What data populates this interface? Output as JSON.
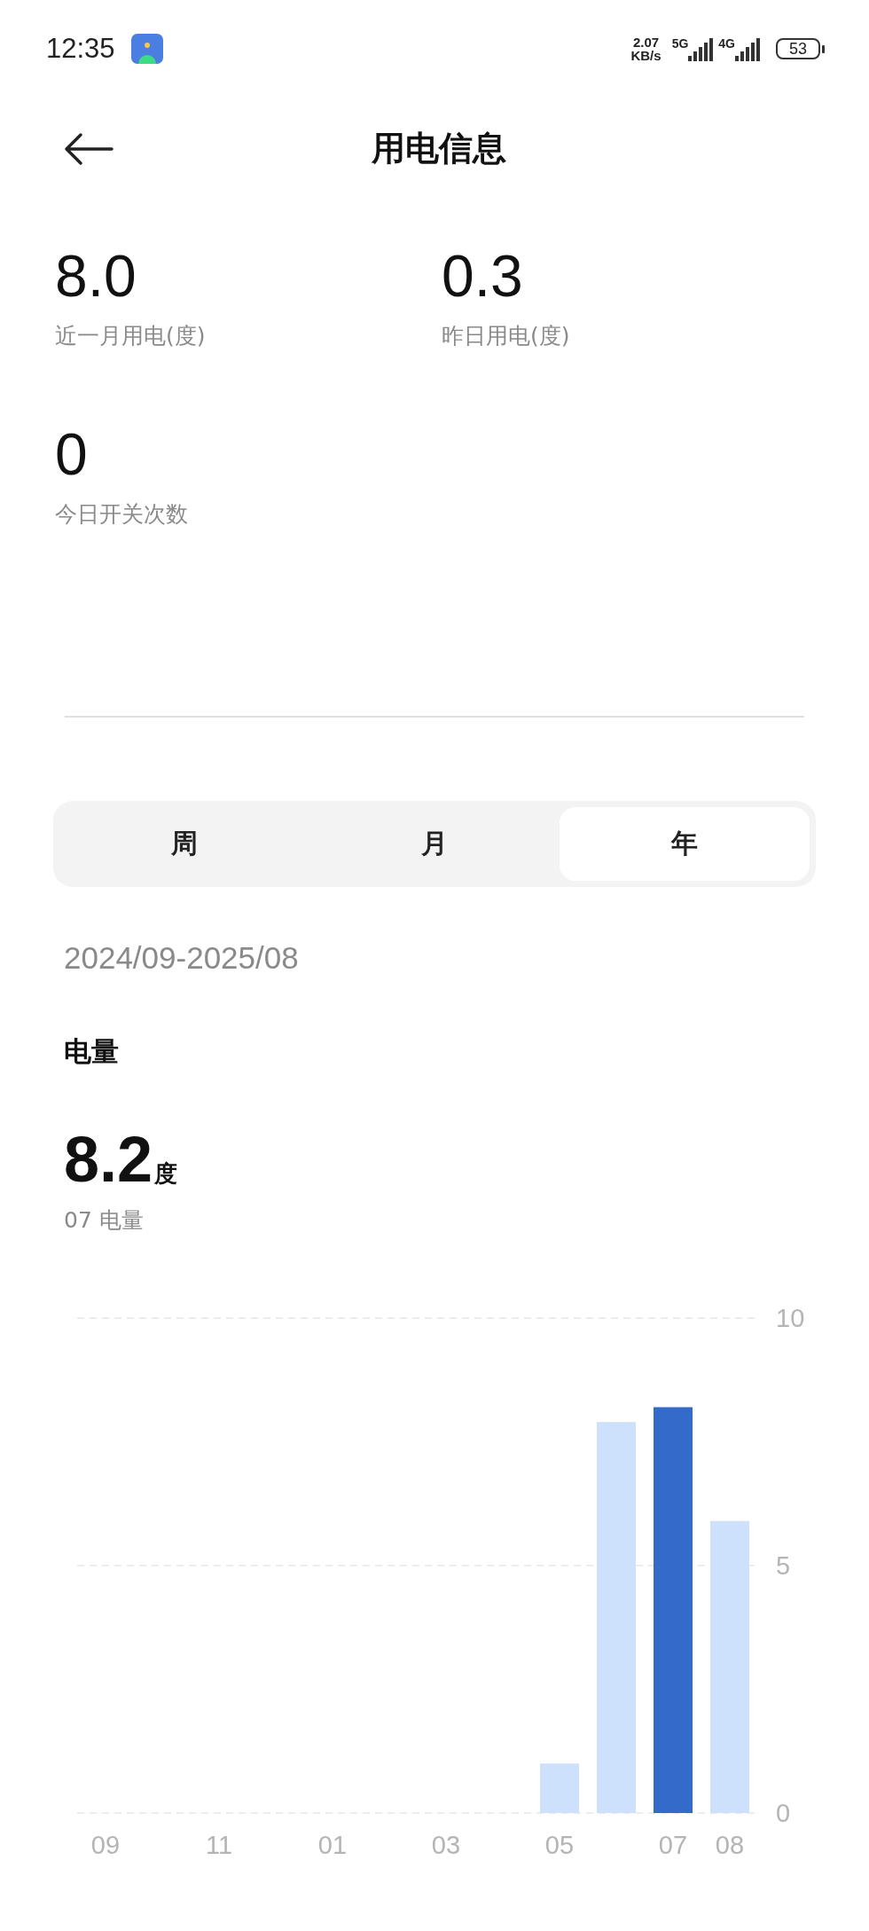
{
  "status_bar": {
    "time": "12:35",
    "speed_value": "2.07",
    "speed_unit": "KB/s",
    "network_1": "5G",
    "network_2": "4G",
    "battery": "53"
  },
  "header": {
    "title": "用电信息"
  },
  "stats": [
    {
      "value": "8.0",
      "label": "近一月用电(度)"
    },
    {
      "value": "0.3",
      "label": "昨日用电(度)"
    },
    {
      "value": "0",
      "label": "今日开关次数"
    }
  ],
  "period_tabs": [
    {
      "label": "周",
      "selected": false
    },
    {
      "label": "月",
      "selected": false
    },
    {
      "label": "年",
      "selected": true
    }
  ],
  "date_range": "2024/09-2025/08",
  "section_title": "电量",
  "summary": {
    "value": "8.2",
    "unit": "度",
    "label": "07 电量"
  },
  "chart_data": {
    "type": "bar",
    "categories": [
      "09",
      null,
      "11",
      null,
      "01",
      null,
      "03",
      null,
      "05",
      null,
      "07",
      "08"
    ],
    "series": [
      {
        "color": "#cde0fc",
        "values": [
          0,
          0,
          0,
          0,
          0,
          0,
          0,
          0,
          1.0,
          7.9,
          null,
          5.9
        ]
      },
      {
        "color": "#346bcb",
        "values": [
          null,
          null,
          null,
          null,
          null,
          null,
          null,
          null,
          null,
          null,
          8.2,
          null
        ]
      }
    ],
    "ylim": [
      0,
      10
    ],
    "yticks": [
      0,
      5,
      10
    ]
  }
}
